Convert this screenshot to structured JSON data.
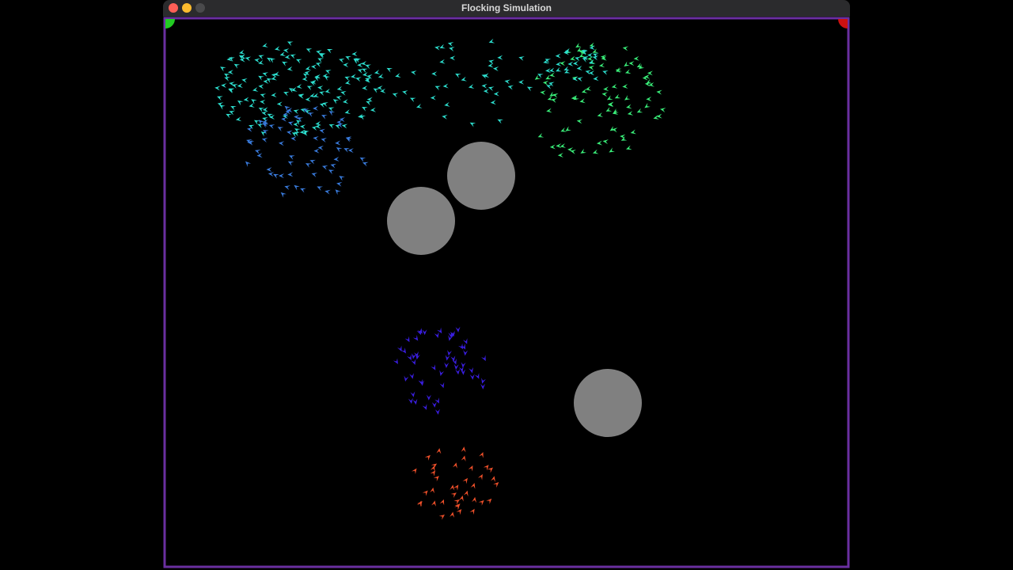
{
  "window": {
    "title": "Flocking Simulation"
  },
  "colors": {
    "border": "#6a2fa0",
    "obstacle": "#808080",
    "corner_tl": "#22cc22",
    "corner_tr": "#cc1111",
    "flock_cyan": "#2de0d0",
    "flock_blue": "#3a7de0",
    "flock_green": "#3af07a",
    "flock_indigo": "#3a1ee0",
    "flock_orange": "#f0502a"
  },
  "icons": {
    "close": "close-icon",
    "minimize": "minimize-icon",
    "zoom": "zoom-icon",
    "boid": "boid-arrow-icon",
    "obstacle": "obstacle-circle"
  }
}
